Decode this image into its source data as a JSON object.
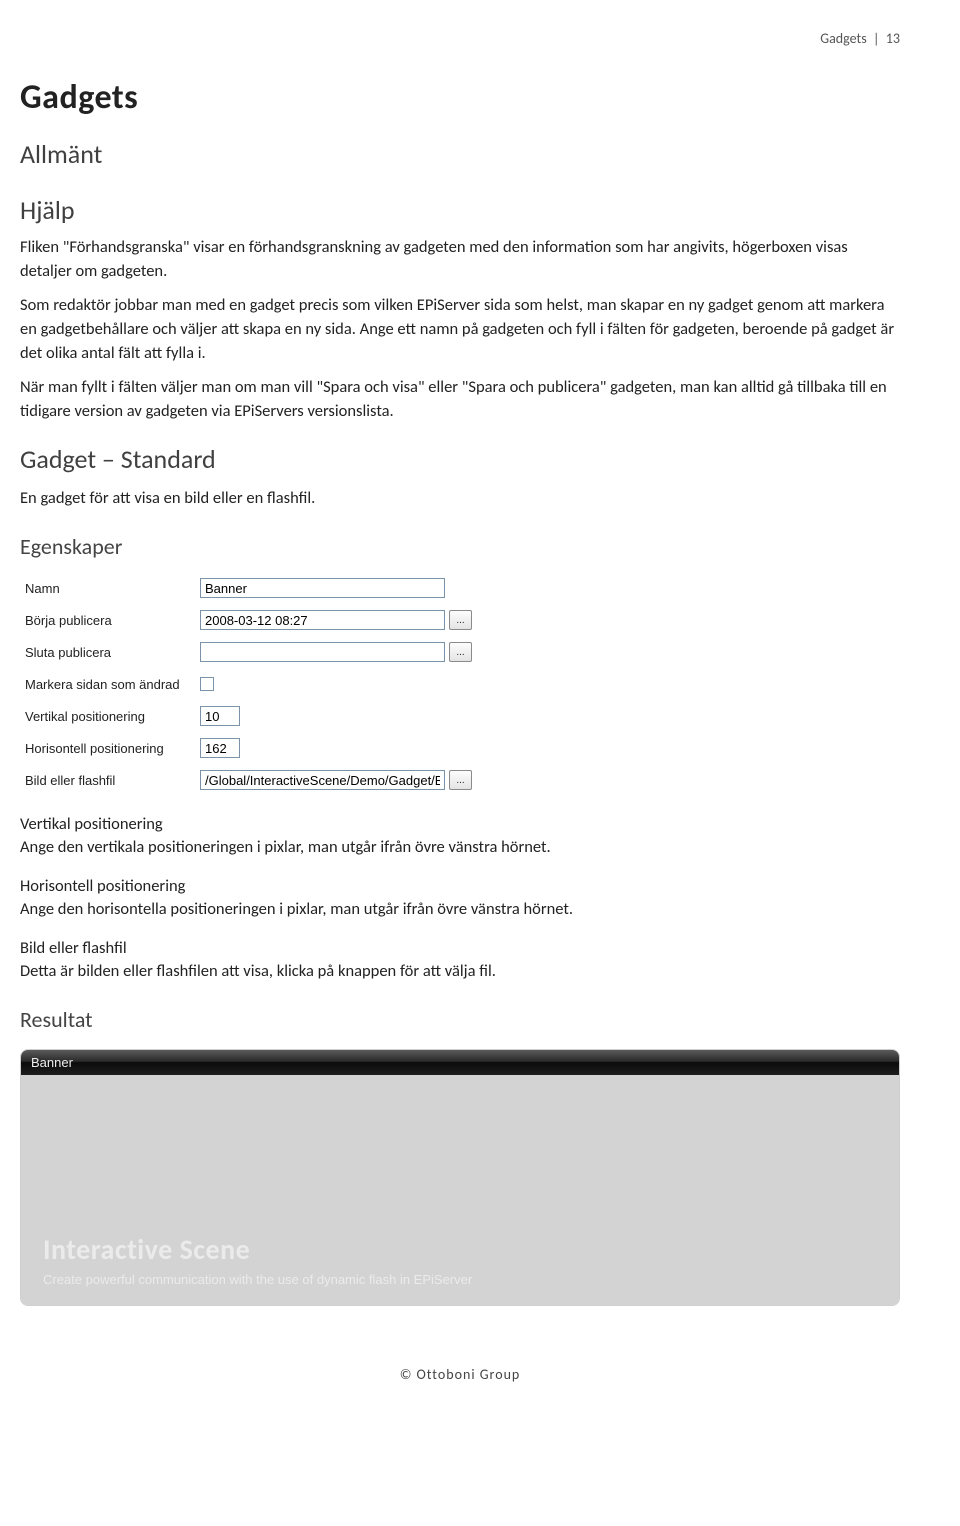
{
  "runhead": {
    "section": "Gadgets",
    "page": "13"
  },
  "h1": "Gadgets",
  "section_allmant": "Allmänt",
  "section_hjalp": "Hjälp",
  "para1": "Fliken \"Förhandsgranska\" visar en förhandsgranskning av gadgeten med den information som har angivits, högerboxen visas detaljer om gadgeten.",
  "para2": "Som redaktör jobbar man med en gadget precis som vilken EPiServer sida som helst, man skapar en ny gadget genom att markera en gadgetbehållare och väljer att skapa en ny sida. Ange ett namn på gadgeten och fyll i fälten för gadgeten, beroende på gadget är det olika antal fält att fylla i.",
  "para3": "När man fyllt i fälten väljer man om man vill \"Spara och visa\" eller \"Spara och publicera\" gadgeten, man kan alltid gå tillbaka till en tidigare version av gadgeten via EPiServers versionslista.",
  "section_gadget_standard": "Gadget – Standard",
  "para4": "En gadget för att visa en bild eller en flashfil.",
  "section_egenskaper": "Egenskaper",
  "form": {
    "rows": [
      {
        "label": "Namn",
        "kind": "text",
        "value": "Banner",
        "width": "w-med"
      },
      {
        "label": "Börja publicera",
        "kind": "textbtn",
        "value": "2008-03-12 08:27",
        "width": "w-med",
        "btn": "..."
      },
      {
        "label": "Sluta publicera",
        "kind": "textbtn",
        "value": "",
        "width": "w-med",
        "btn": "..."
      },
      {
        "label": "Markera sidan som ändrad",
        "kind": "checkbox",
        "checked": false
      },
      {
        "label": "Vertikal positionering",
        "kind": "text",
        "value": "10",
        "width": "w-sm"
      },
      {
        "label": "Horisontell positionering",
        "kind": "text",
        "value": "162",
        "width": "w-sm"
      },
      {
        "label": "Bild eller flashfil",
        "kind": "textbtn",
        "value": "/Global/InteractiveScene/Demo/Gadget/Ba",
        "width": "w-med",
        "btn": "..."
      }
    ]
  },
  "defs": [
    {
      "term": "Vertikal positionering",
      "desc": "Ange den vertikala positioneringen i pixlar, man utgår ifrån övre vänstra hörnet."
    },
    {
      "term": "Horisontell positionering",
      "desc": "Ange den horisontella positioneringen i pixlar, man utgår ifrån övre vänstra hörnet."
    },
    {
      "term": "Bild eller flashfil",
      "desc": "Detta är bilden eller flashfilen att visa, klicka på knappen för att välja fil."
    }
  ],
  "section_resultat": "Resultat",
  "result_preview": {
    "window_title": "Banner",
    "headline": "Interactive Scene",
    "subline": "Create powerful communication with the use of dynamic flash in EPiServer"
  },
  "footer": "© Ottoboni Group"
}
